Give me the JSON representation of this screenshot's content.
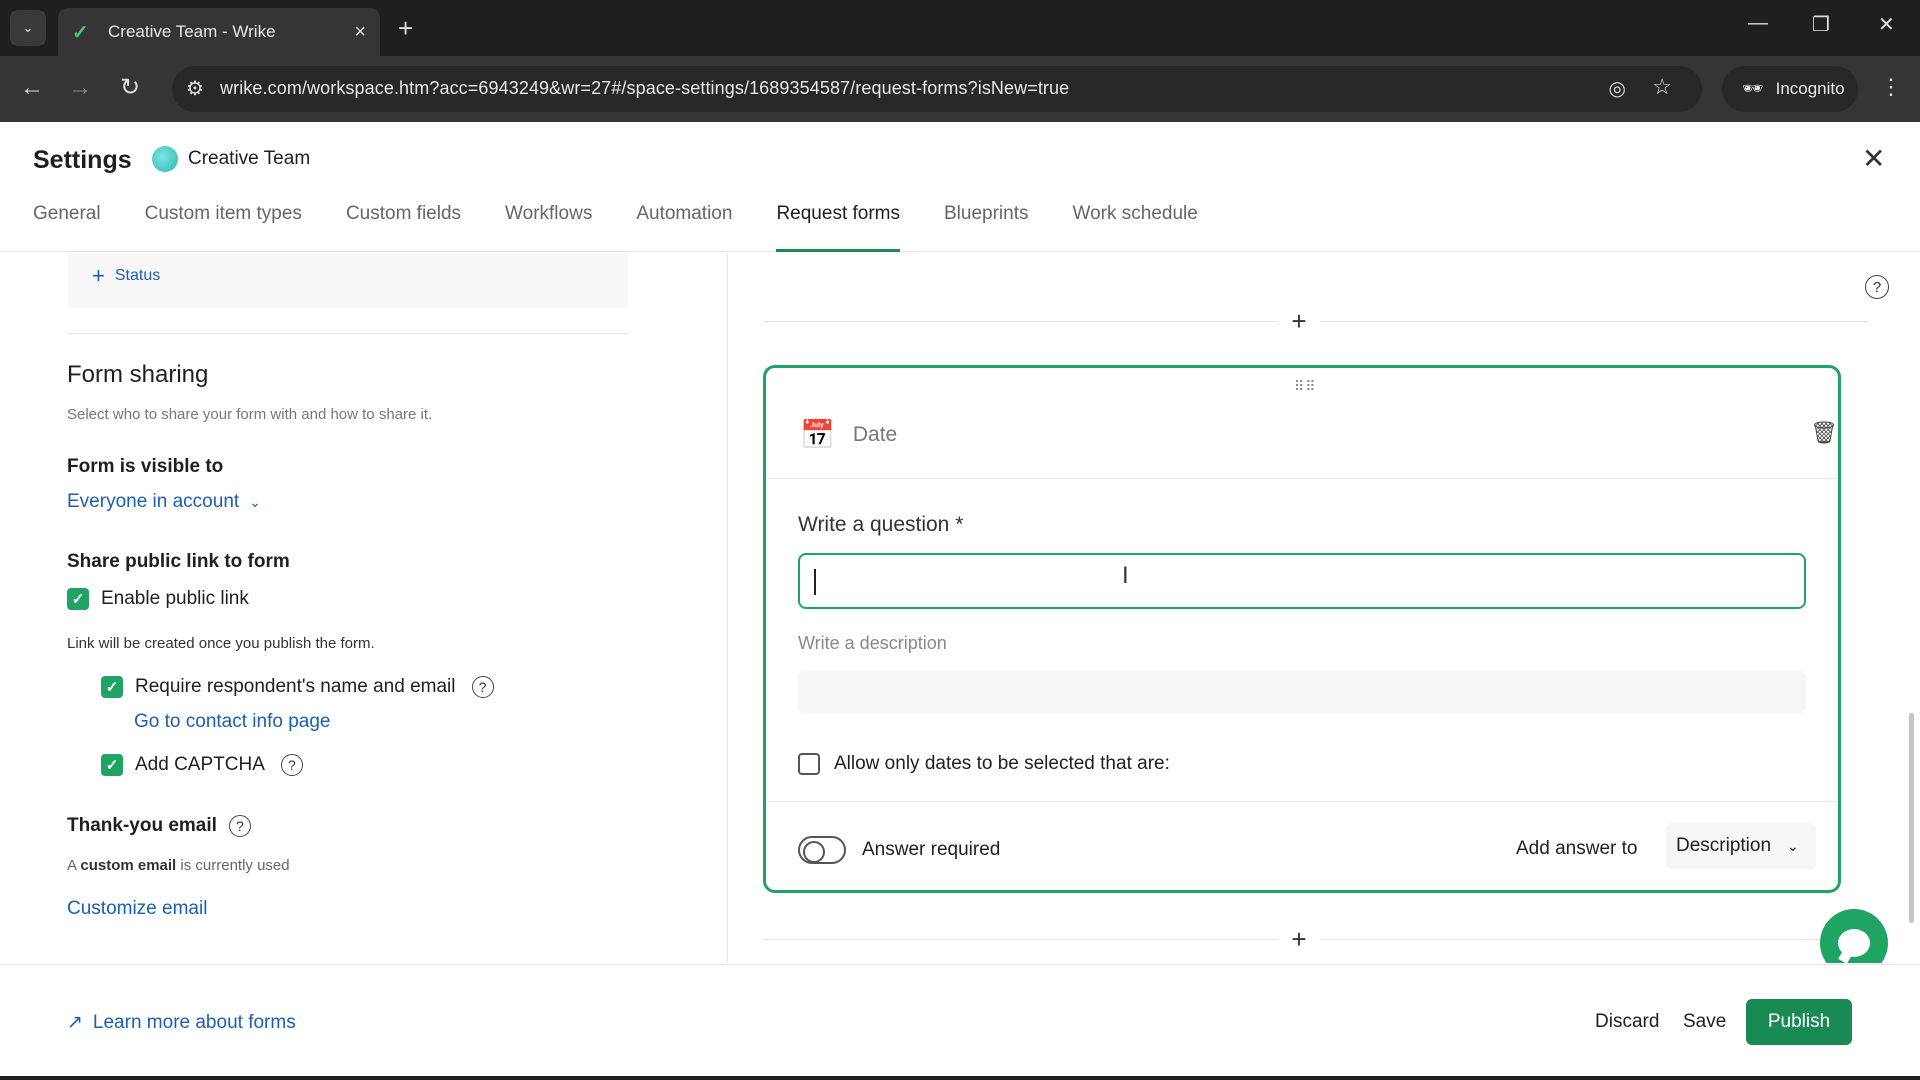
{
  "browser": {
    "tab_title": "Creative Team - Wrike",
    "url": "wrike.com/workspace.htm?acc=6943249&wr=27#/space-settings/1689354587/request-forms?isNew=true",
    "incognito_label": "Incognito"
  },
  "settings": {
    "title": "Settings",
    "space_name": "Creative Team",
    "tabs": [
      "General",
      "Custom item types",
      "Custom fields",
      "Workflows",
      "Automation",
      "Request forms",
      "Blueprints",
      "Work schedule"
    ],
    "active_tab": "Request forms"
  },
  "left": {
    "status_add": "Status",
    "form_sharing": {
      "title": "Form sharing",
      "description": "Select who to share your form with and how to share it.",
      "visible_label": "Form is visible to",
      "visible_value": "Everyone in account",
      "public_link_label": "Share public link to form",
      "enable_public_link": "Enable public link",
      "link_note": "Link will be created once you publish the form.",
      "require_name_email": "Require respondent's name and email",
      "contact_link": "Go to contact info page",
      "captcha": "Add CAPTCHA",
      "thank_you_label": "Thank-you email",
      "custom_email_prefix": "A",
      "custom_email_bold": "custom email",
      "custom_email_suffix": "is currently used",
      "customize_link": "Customize email"
    }
  },
  "card": {
    "type_label": "Date",
    "question_label": "Write a question *",
    "question_value": "",
    "description_label": "Write a description",
    "allow_dates_label": "Allow only dates to be selected that are:",
    "answer_required_label": "Answer required",
    "add_answer_label": "Add answer to",
    "add_answer_value": "Description"
  },
  "footer": {
    "learn_more": "Learn more about forms",
    "discard": "Discard",
    "save": "Save",
    "publish": "Publish"
  },
  "colors": {
    "accent": "#1fa463",
    "publish": "#1a8a55",
    "link": "#1a5fb4"
  }
}
